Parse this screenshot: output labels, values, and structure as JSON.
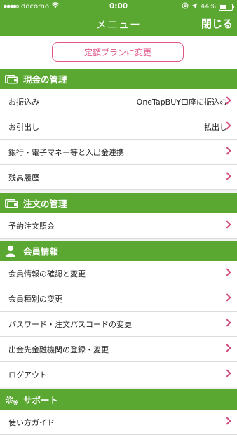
{
  "status": {
    "carrier": "docomo",
    "time": "0:00",
    "battery": "44%",
    "battery_level": 0.44
  },
  "nav": {
    "title": "メニュー",
    "close": "閉じる"
  },
  "plan_button": "定額プランに変更",
  "sections": {
    "cash": {
      "title": "現金の管理",
      "items": [
        {
          "label": "お振込み",
          "value": "OneTapBUY口座に振込む"
        },
        {
          "label": "お引出し",
          "value": "払出し"
        },
        {
          "label": "銀行・電子マネー等と入出金連携"
        },
        {
          "label": "残高履歴"
        }
      ]
    },
    "orders": {
      "title": "注文の管理",
      "items": [
        {
          "label": "予約注文照会"
        }
      ]
    },
    "member": {
      "title": "会員情報",
      "items": [
        {
          "label": "会員情報の確認と変更"
        },
        {
          "label": "会員種別の変更"
        },
        {
          "label": "パスワード・注文パスコードの変更"
        },
        {
          "label": "出金先金融機関の登録・変更"
        },
        {
          "label": "ログアウト"
        }
      ]
    },
    "support": {
      "title": "サポート",
      "items": [
        {
          "label": "使い方ガイド"
        }
      ]
    }
  },
  "colors": {
    "accent": "#5aa832",
    "pink": "#e0578a"
  },
  "icons": [
    "signal-icon",
    "wifi-icon",
    "lock-rotation-icon",
    "location-arrow-icon",
    "battery-icon",
    "wallet-icon",
    "person-icon",
    "gear-icon",
    "chevron-right-icon"
  ]
}
